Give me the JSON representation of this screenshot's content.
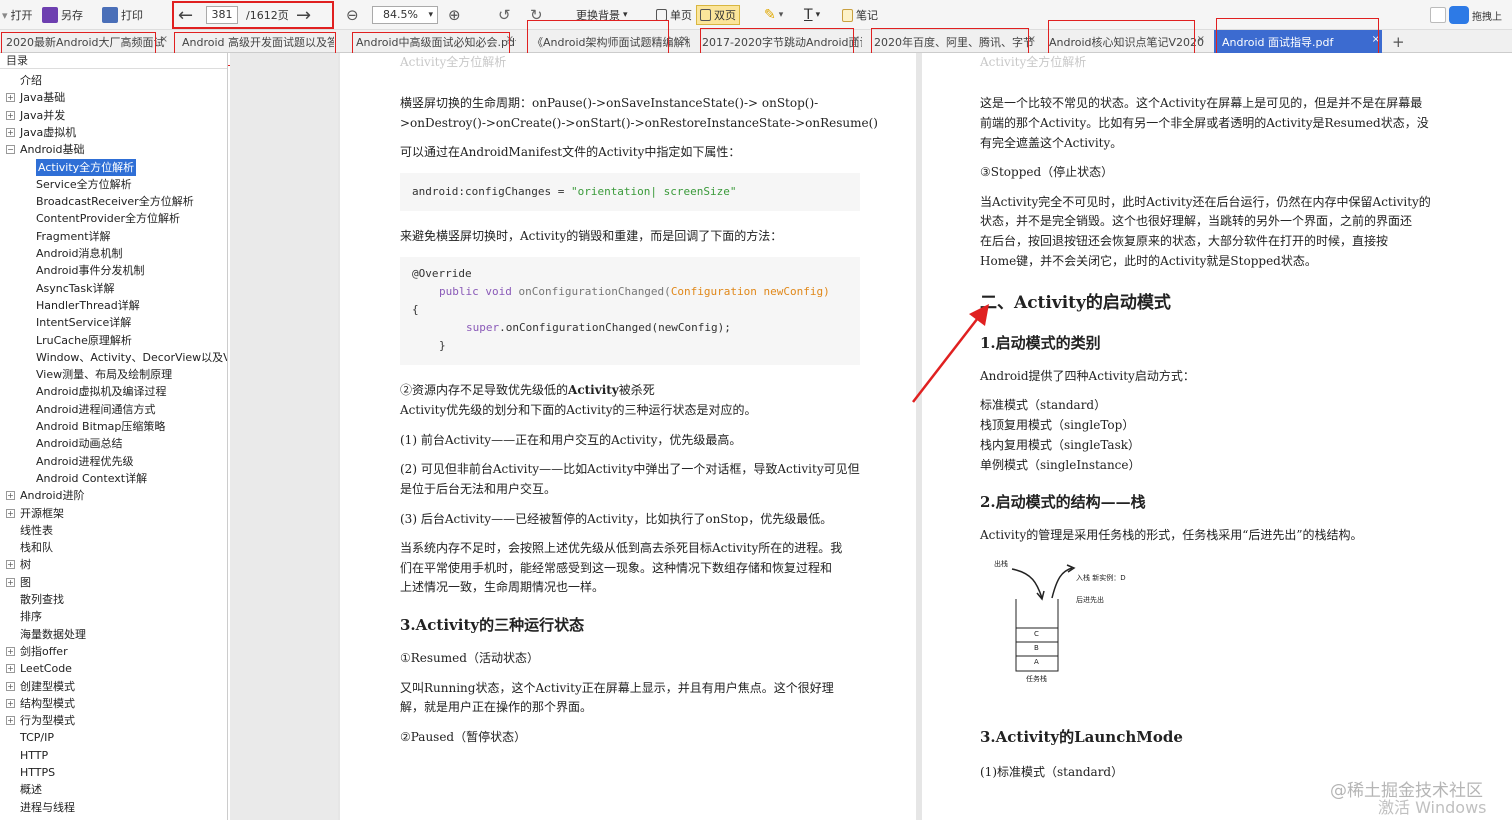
{
  "toolbar": {
    "open": "打开",
    "save_as": "另存",
    "print": "打印",
    "page_current": "381",
    "page_total": "/1612页",
    "zoom": "84.5%",
    "bg": "更换背景",
    "single": "单页",
    "double": "双页",
    "notes": "笔记",
    "upload": "拖拽上"
  },
  "tabs": [
    {
      "label": "2020最新Android大厂高频面试"
    },
    {
      "label": "Android 高级开发面试题以及答案"
    },
    {
      "label": "Android中高级面试必知必会.pdf"
    },
    {
      "label": "《Android架构师面试题精编解析"
    },
    {
      "label": "2017-2020字节跳动Android面试"
    },
    {
      "label": "2020年百度、阿里、腾讯、字节"
    },
    {
      "label": "Android核心知识点笔记V2020"
    },
    {
      "label": "Android 面试指导.pdf"
    }
  ],
  "sidebar": {
    "title": "目录",
    "items": [
      {
        "label": "介绍"
      },
      {
        "label": "Java基础"
      },
      {
        "label": "Java并发"
      },
      {
        "label": "Java虚拟机"
      },
      {
        "label": "Android基础"
      },
      {
        "label": "Activity全方位解析"
      },
      {
        "label": "Service全方位解析"
      },
      {
        "label": "BroadcastReceiver全方位解析"
      },
      {
        "label": "ContentProvider全方位解析"
      },
      {
        "label": "Fragment详解"
      },
      {
        "label": "Android消息机制"
      },
      {
        "label": "Android事件分发机制"
      },
      {
        "label": "AsyncTask详解"
      },
      {
        "label": "HandlerThread详解"
      },
      {
        "label": "IntentService详解"
      },
      {
        "label": "LruCache原理解析"
      },
      {
        "label": "Window、Activity、DecorView以及Vie"
      },
      {
        "label": "View测量、布局及绘制原理"
      },
      {
        "label": "Android虚拟机及编译过程"
      },
      {
        "label": "Android进程间通信方式"
      },
      {
        "label": "Android Bitmap压缩策略"
      },
      {
        "label": "Android动画总结"
      },
      {
        "label": "Android进程优先级"
      },
      {
        "label": "Android Context详解"
      },
      {
        "label": "Android进阶"
      },
      {
        "label": "开源框架"
      },
      {
        "label": "线性表"
      },
      {
        "label": "栈和队"
      },
      {
        "label": "树"
      },
      {
        "label": "图"
      },
      {
        "label": "散列查找"
      },
      {
        "label": "排序"
      },
      {
        "label": "海量数据处理"
      },
      {
        "label": "剑指offer"
      },
      {
        "label": "LeetCode"
      },
      {
        "label": "创建型模式"
      },
      {
        "label": "结构型模式"
      },
      {
        "label": "行为型模式"
      },
      {
        "label": "TCP/IP"
      },
      {
        "label": "HTTP"
      },
      {
        "label": "HTTPS"
      },
      {
        "label": "概述"
      },
      {
        "label": "进程与线程"
      }
    ]
  },
  "left_page": {
    "header": "Activity全方位解析",
    "l1": "横竖屏切换的生命周期：onPause()->onSaveInstanceState()-> onStop()-",
    "l2": ">onDestroy()->onCreate()->onStart()->onRestoreInstanceState->onResume()",
    "l3": "可以通过在AndroidManifest文件的Activity中指定如下属性：",
    "code1_a": "android:configChanges = ",
    "code1_b": "\"orientation| screenSize\"",
    "l4": "来避免横竖屏切换时，Activity的销毁和重建，而是回调了下面的方法：",
    "code2_l1": "@Override",
    "code2_kw": "public void",
    "code2_m": " onConfigurationChanged(",
    "code2_p": "Configuration newConfig)",
    "code2_l3": "{",
    "code2_sup": "super",
    "code2_call": ".onConfigurationChanged(newConfig);",
    "code2_l5": "}",
    "l5a": "②资源内存不足导致优先级低的",
    "l5b": "Activity",
    "l5c": "被杀死",
    "l6": "Activity优先级的划分和下面的Activity的三种运行状态是对应的。",
    "l7": "(1) 前台Activity——正在和用户交互的Activity，优先级最高。",
    "l8": "(2) 可见但非前台Activity——比如Activity中弹出了一个对话框，导致Activity可见但",
    "l9": "是位于后台无法和用户交互。",
    "l10": "(3) 后台Activity——已经被暂停的Activity，比如执行了onStop，优先级最低。",
    "l11": "当系统内存不足时，会按照上述优先级从低到高去杀死目标Activity所在的进程。我",
    "l12": "们在平常使用手机时，能经常感受到这一现象。这种情况下数组存储和恢复过程和",
    "l13": "上述情况一致，生命周期情况也一样。",
    "h3": "3.Activity的三种运行状态",
    "l14": "①Resumed（活动状态）",
    "l15": "又叫Running状态，这个Activity正在屏幕上显示，并且有用户焦点。这个很好理",
    "l16": "解，就是用户正在操作的那个界面。",
    "l17": "②Paused（暂停状态）"
  },
  "right_page": {
    "header": "Activity全方位解析",
    "r1": "这是一个比较不常见的状态。这个Activity在屏幕上是可见的，但是并不是在屏幕最",
    "r2": "前端的那个Activity。比如有另一个非全屏或者透明的Activity是Resumed状态，没",
    "r3": "有完全遮盖这个Activity。",
    "r4": "③Stopped（停止状态）",
    "r5": "当Activity完全不可见时，此时Activity还在后台运行，仍然在内存中保留Activity的",
    "r6": "状态，并不是完全销毁。这个也很好理解，当跳转的另外一个界面，之前的界面还",
    "r7": "在后台，按回退按钮还会恢复原来的状态，大部分软件在打开的时候，直接按",
    "r8": "Home键，并不会关闭它，此时的Activity就是Stopped状态。",
    "h2": "二、Activity的启动模式",
    "h3a": "1.启动模式的类别",
    "r9": "Android提供了四种Activity启动方式：",
    "r10": "标准模式（standard）",
    "r11": "栈顶复用模式（singleTop）",
    "r12": "栈内复用模式（singleTask）",
    "r13": "单例模式（singleInstance）",
    "h3b": "2.启动模式的结构——栈",
    "r14": "Activity的管理是采用任务栈的形式，任务栈采用“后进先出”的栈结构。",
    "fig_out": "出栈",
    "fig_in": "入栈  新实例：D",
    "fig_lifo": "后进先出",
    "fig_c": "C",
    "fig_b": "B",
    "fig_a": "A",
    "fig_task": "任务栈",
    "h3c": "3.Activity的LaunchMode",
    "r15": "(1)标准模式（standard）"
  },
  "watermark": {
    "juejin": "@稀土掘金技术社区",
    "windows": "激活 Windows"
  },
  "colors": {
    "annotation": "#e02020",
    "active_tab": "#3c6bd0",
    "selected_item": "#2f6fd6"
  }
}
